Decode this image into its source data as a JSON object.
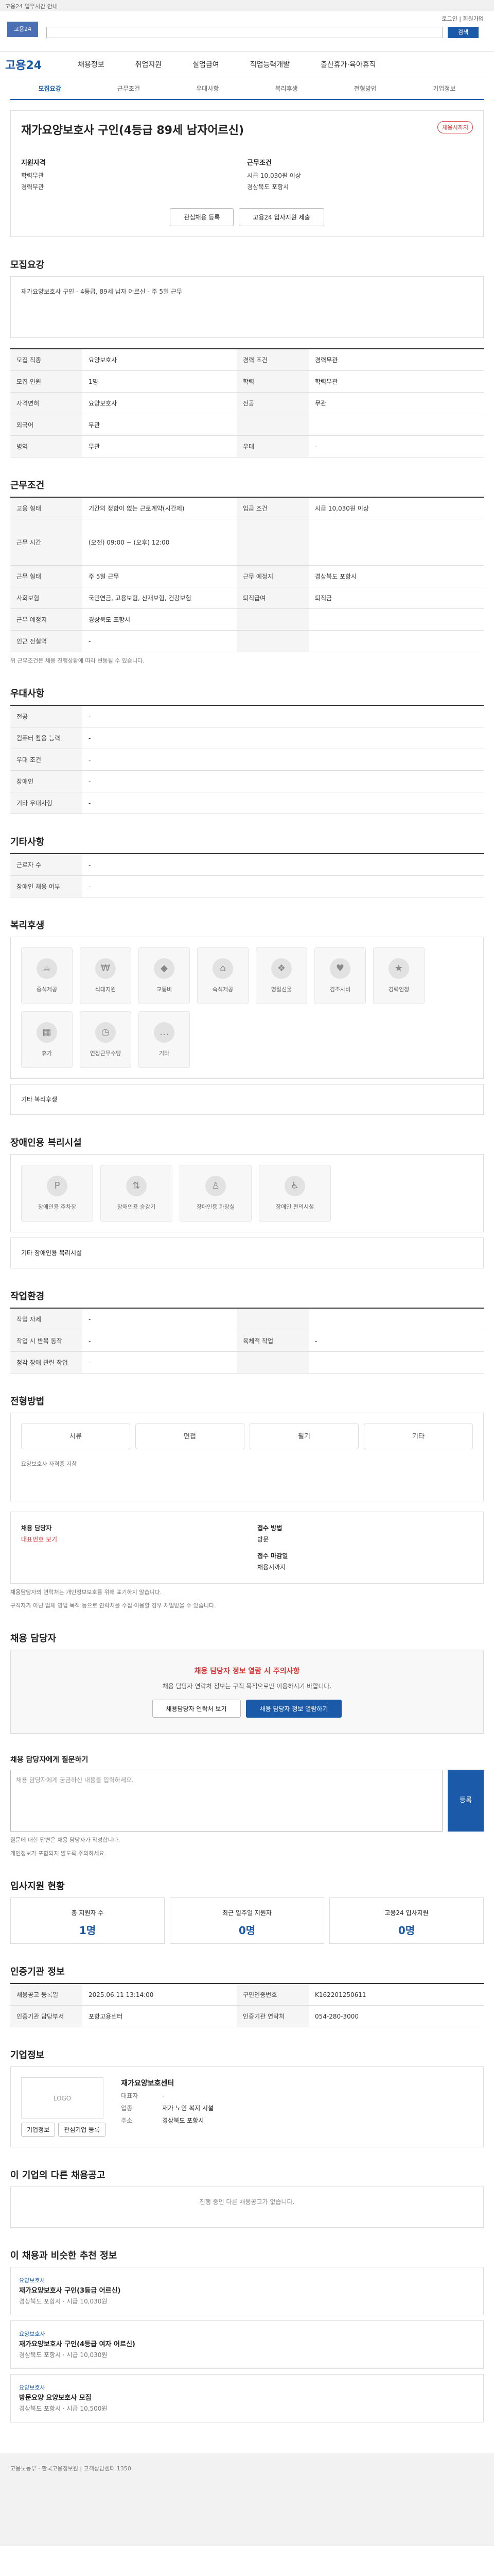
{
  "header": {
    "notice": "고용24 업무시간 안내",
    "logo": "고용24",
    "search_label": "검색",
    "util": "로그인 | 회원가입"
  },
  "gnb": {
    "brand": "고용24",
    "items": [
      "채용정보",
      "취업지원",
      "실업급여",
      "직업능력개발",
      "출산휴가·육아휴직"
    ]
  },
  "tabs": [
    "모집요강",
    "근무조건",
    "우대사항",
    "복리후생",
    "전형방법",
    "기업정보"
  ],
  "job": {
    "title": "재가요양보호사 구인(4등급 89세 남자어르신)",
    "status": "채용시까지",
    "left_title": "지원자격",
    "left": {
      "edu": "학력무관",
      "career": "경력무관"
    },
    "right_title": "근무조건",
    "right": {
      "wage": "시급 10,030원 이상",
      "region": "경상북도 포항시"
    },
    "btn_interest": "관심채용 등록",
    "btn_share": "고용24 입사지원 제출"
  },
  "recruit": {
    "heading": "모집요강",
    "desc": "재가요양보호사 구인 - 4등급, 89세 남자 어르신 - 주 5일 근무",
    "rows": [
      [
        "모집 직종",
        "요양보호사",
        "경력 조건",
        "경력무관"
      ],
      [
        "모집 인원",
        "1명",
        "학력",
        "학력무관"
      ],
      [
        "자격면허",
        "요양보호사",
        "전공",
        "무관"
      ],
      [
        "외국어",
        "무관",
        "",
        ""
      ],
      [
        "병역",
        "무관",
        "우대",
        "-"
      ]
    ]
  },
  "workcond": {
    "heading": "근무조건",
    "rows": [
      [
        "고용 형태",
        "기간의 정함이 없는 근로계약(시간제)",
        "임금 조건",
        "시급 10,030원 이상"
      ],
      [
        "근무 시간",
        "(오전) 09:00 ~ (오후) 12:00",
        "",
        ""
      ],
      [
        "근무 형태",
        "주 5일 근무",
        "근무 예정지",
        "경상북도 포항시"
      ],
      [
        "사회보험",
        "국민연금, 고용보험, 산재보험, 건강보험",
        "퇴직급여",
        "퇴직금"
      ],
      [
        "근무 예정지",
        "경상북도 포항시",
        "",
        ""
      ],
      [
        "인근 전철역",
        "-",
        "",
        ""
      ]
    ],
    "note": "위 근무조건은 채용 진행상황에 따라 변동될 수 있습니다."
  },
  "pref": {
    "heading": "우대사항",
    "rows": [
      [
        "전공",
        "-"
      ],
      [
        "컴퓨터 활용 능력",
        "-"
      ],
      [
        "우대 조건",
        "-"
      ],
      [
        "장애인",
        "-"
      ],
      [
        "기타 우대사항",
        "-"
      ]
    ]
  },
  "etc": {
    "heading": "기타사항",
    "rows": [
      [
        "근로자 수",
        "-"
      ],
      [
        "장애인 채용 여부",
        "-"
      ]
    ]
  },
  "welfare": {
    "heading": "복리후생",
    "items": [
      "중식제공",
      "식대지원",
      "교통비",
      "숙식제공",
      "명절선물",
      "경조사비",
      "경력인정",
      "휴가",
      "연장근무수당",
      "기타"
    ],
    "note": "기타 복리후생"
  },
  "disability": {
    "heading": "장애인용 복리시설",
    "items": [
      "장애인용 주차장",
      "장애인용 승강기",
      "장애인용 화장실",
      "장애인 편의시설"
    ],
    "note": "기타 장애인용 복리시설"
  },
  "workenv": {
    "heading": "작업환경",
    "rows": [
      [
        "작업 자세",
        "-",
        "",
        ""
      ],
      [
        "작업 시 반복 동작",
        "-",
        "육체적 작업",
        "-"
      ],
      [
        "청각 장애 관련 작업",
        "-",
        "",
        ""
      ]
    ]
  },
  "process": {
    "heading": "전형방법",
    "options": [
      "서류",
      "면접",
      "필기",
      "기타"
    ],
    "note": "요양보호사 자격증 지참"
  },
  "contact": {
    "manager": "채용 담당자",
    "manager_phone": "대표번호 보기",
    "method_label": "접수 방법",
    "method": "방문",
    "period_label": "접수 마감일",
    "period": "채용시까지",
    "notes": [
      "채용담당자의 연락처는 개인정보보호를 위해 표기하지 않습니다.",
      "구직자가 아닌 업체 영업 목적 등으로 연락처를 수집·이용할 경우 처벌받을 수 있습니다."
    ]
  },
  "alert": {
    "heading": "채용 담당자",
    "title": "채용 담당자 정보 열람 시 주의사항",
    "text": "채용 담당자 연락처 정보는 구직 목적으로만 이용하시기 바랍니다.",
    "btn_a": "채용담당자 연락처 보기",
    "btn_b": "채용 담당자 정보 열람하기"
  },
  "inquiry": {
    "heading": "채용 담당자에게 질문하기",
    "placeholder": "채용 담당자에게 궁금하신 내용을 입력하세요.",
    "send": "등록",
    "notes": [
      "질문에 대한 답변은 채용 담당자가 작성합니다.",
      "개인정보가 포함되지 않도록 주의하세요."
    ]
  },
  "stats": {
    "heading": "입사지원 현황",
    "items": [
      {
        "label": "총 지원자 수",
        "value": "1명"
      },
      {
        "label": "최근 일주일 지원자",
        "value": "0명"
      },
      {
        "label": "고용24 입사지원",
        "value": "0명"
      }
    ]
  },
  "info": {
    "heading": "인증기관 정보",
    "rows": [
      [
        "채용공고 등록일",
        "2025.06.11 13:14:00",
        "구인인증번호",
        "K162201250611"
      ],
      [
        "인증기관 담당부서",
        "포항고용센터",
        "인증기관 연락처",
        "054-280-3000"
      ]
    ]
  },
  "company": {
    "heading": "기업정보",
    "logo": "LOGO",
    "name": "재가요양보호센터",
    "rows": [
      [
        "대표자",
        "-"
      ],
      [
        "업종",
        "재가 노인 복지 시설"
      ],
      [
        "주소",
        "경상북도 포항시"
      ]
    ],
    "btn_a": "기업정보",
    "btn_b": "관심기업 등록"
  },
  "related": {
    "heading": "이 기업의 다른 채용공고",
    "empty": "진행 중인 다른 채용공고가 없습니다."
  },
  "recommend": {
    "heading": "이 채용과 비슷한 추천 정보",
    "items": [
      {
        "tag": "요양보호사",
        "title": "재가요양보호사 구인(3등급 어르신)",
        "meta": "경상북도 포항시 · 시급 10,030원"
      },
      {
        "tag": "요양보호사",
        "title": "재가요양보호사 구인(4등급 여자 어르신)",
        "meta": "경상북도 포항시 · 시급 10,030원"
      },
      {
        "tag": "요양보호사",
        "title": "방문요양 요양보호사 모집",
        "meta": "경상북도 포항시 · 시급 10,500원"
      }
    ]
  },
  "footer": {
    "text": "고용노동부 · 한국고용정보원 | 고객상담센터 1350"
  }
}
